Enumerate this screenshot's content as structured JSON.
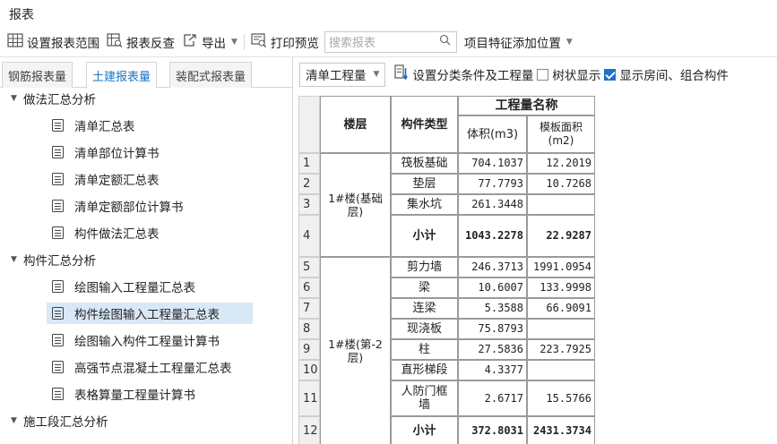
{
  "window": {
    "title": "报表"
  },
  "toolbar": {
    "set_range": "设置报表范围",
    "reverse": "报表反查",
    "export": "导出",
    "print_preview": "打印预览",
    "search_placeholder": "搜索报表",
    "add_position": "项目特征添加位置"
  },
  "tabs": [
    "钢筋报表量",
    "土建报表量",
    "装配式报表量"
  ],
  "tree": {
    "group1": "做法汇总分析",
    "g1_items": [
      "清单汇总表",
      "清单部位计算书",
      "清单定额汇总表",
      "清单定额部位计算书",
      "构件做法汇总表"
    ],
    "group2": "构件汇总分析",
    "g2_items": [
      "绘图输入工程量汇总表",
      "构件绘图输入工程量汇总表",
      "绘图输入构件工程量计算书",
      "高强节点混凝土工程量汇总表",
      "表格算量工程量计算书"
    ],
    "group3": "施工段汇总分析"
  },
  "report_toolbar": {
    "mode": "清单工程量",
    "set_category": "设置分类条件及工程量",
    "tree_display": "树状显示",
    "tree_display_checked": false,
    "show_room": "显示房间、组合构件",
    "show_room_checked": true
  },
  "table": {
    "h_floor": "楼层",
    "h_type": "构件类型",
    "h_qty": "工程量名称",
    "h_vol": "体积(m3)",
    "h_area": "模板面积(m2)",
    "floor1": "1#楼(基础层)",
    "floor2": "1#楼(第-2层)",
    "rows": [
      {
        "n": "1",
        "type": "筏板基础",
        "vol": "704.1037",
        "area": "12.2019"
      },
      {
        "n": "2",
        "type": "垫层",
        "vol": "77.7793",
        "area": "10.7268"
      },
      {
        "n": "3",
        "type": "集水坑",
        "vol": "261.3448",
        "area": ""
      },
      {
        "n": "4",
        "type": "小计",
        "vol": "1043.2278",
        "area": "22.9287"
      },
      {
        "n": "5",
        "type": "剪力墙",
        "vol": "246.3713",
        "area": "1991.0954"
      },
      {
        "n": "6",
        "type": "梁",
        "vol": "10.6007",
        "area": "133.9998"
      },
      {
        "n": "7",
        "type": "连梁",
        "vol": "5.3588",
        "area": "66.9091"
      },
      {
        "n": "8",
        "type": "现浇板",
        "vol": "75.8793",
        "area": ""
      },
      {
        "n": "9",
        "type": "柱",
        "vol": "27.5836",
        "area": "223.7925"
      },
      {
        "n": "10",
        "type": "直形梯段",
        "vol": "4.3377",
        "area": ""
      },
      {
        "n": "11",
        "type": "人防门框墙",
        "vol": "2.6717",
        "area": "15.5766"
      },
      {
        "n": "12",
        "type": "小计",
        "vol": "372.8031",
        "area": "2431.3734"
      }
    ]
  },
  "colors": {
    "accent": "#1a73c8",
    "selected_bg": "#d9e8f6"
  }
}
